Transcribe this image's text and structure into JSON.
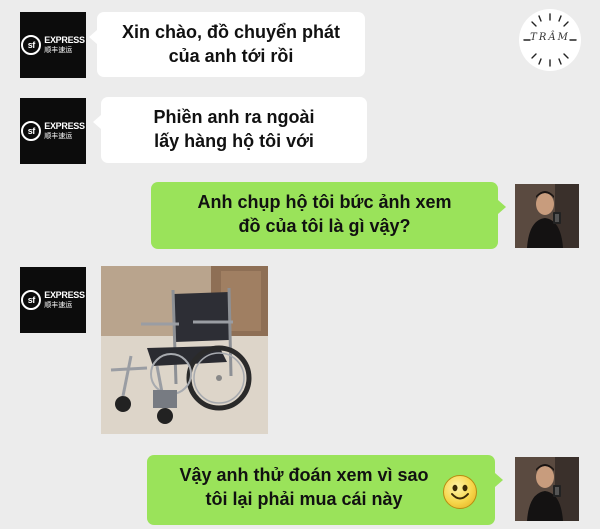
{
  "watermark": {
    "text": "TRÂM"
  },
  "sender": {
    "name": "SF EXPRESS",
    "logo_letters": "sf",
    "logo_word": "EXPRESS",
    "logo_cn": "顺丰速运"
  },
  "messages": [
    {
      "from": "sender",
      "type": "text",
      "text_line1": "Xin chào, đồ chuyển phát",
      "text_line2": "của anh tới rồi"
    },
    {
      "from": "sender",
      "type": "text",
      "text_line1": "Phiền anh ra ngoài",
      "text_line2": "lấy hàng hộ tôi với"
    },
    {
      "from": "me",
      "type": "text",
      "text_line1": "Anh chụp hộ tôi bức ảnh xem",
      "text_line2": "đồ của tôi là gì vậy?"
    },
    {
      "from": "sender",
      "type": "image",
      "image_subject": "wheelchair"
    },
    {
      "from": "me",
      "type": "text",
      "text_line1": "Vậy anh thử đoán xem vì sao",
      "text_line2": "tôi lại phải mua cái này",
      "emoji": "smiley-face"
    }
  ],
  "colors": {
    "background": "#ececec",
    "incoming_bubble": "#ffffff",
    "outgoing_bubble": "#9ae35a"
  }
}
